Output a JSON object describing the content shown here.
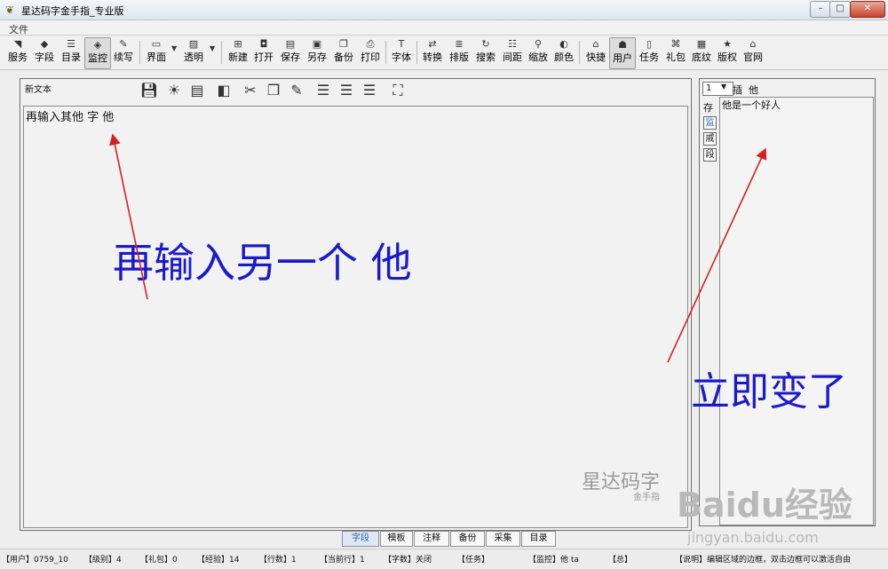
{
  "window": {
    "title": "星达码字金手指_专业版",
    "buttons": [
      "–",
      "□",
      "✕"
    ]
  },
  "menu": {
    "file": "文件"
  },
  "toolbar": {
    "items": [
      {
        "label": "服务",
        "icon": "rss-icon"
      },
      {
        "label": "字段",
        "icon": "diamond-icon"
      },
      {
        "label": "目录",
        "icon": "list-icon"
      },
      {
        "label": "监控",
        "icon": "shield-icon",
        "active": true
      },
      {
        "label": "续写",
        "icon": "pen-icon"
      },
      {
        "label": "界面",
        "icon": "window-icon"
      },
      {
        "label": "透明",
        "icon": "image-icon"
      },
      {
        "label": "新建",
        "icon": "new-file-icon"
      },
      {
        "label": "打开",
        "icon": "open-icon"
      },
      {
        "label": "保存",
        "icon": "save-icon"
      },
      {
        "label": "另存",
        "icon": "save-as-icon"
      },
      {
        "label": "备份",
        "icon": "backup-icon"
      },
      {
        "label": "打印",
        "icon": "print-icon"
      },
      {
        "label": "字体",
        "icon": "font-icon"
      },
      {
        "label": "转换",
        "icon": "convert-icon"
      },
      {
        "label": "排版",
        "icon": "layout-icon"
      },
      {
        "label": "搜索",
        "icon": "refresh-icon"
      },
      {
        "label": "间距",
        "icon": "spacing-icon"
      },
      {
        "label": "缩放",
        "icon": "zoom-icon"
      },
      {
        "label": "颜色",
        "icon": "palette-icon"
      },
      {
        "label": "快捷",
        "icon": "shortcut-icon"
      },
      {
        "label": "用户",
        "icon": "user-icon",
        "active": true
      },
      {
        "label": "任务",
        "icon": "task-icon"
      },
      {
        "label": "礼包",
        "icon": "gift-icon"
      },
      {
        "label": "底纹",
        "icon": "texture-icon"
      },
      {
        "label": "版权",
        "icon": "star-icon"
      },
      {
        "label": "官网",
        "icon": "home-icon"
      }
    ]
  },
  "editor": {
    "name": "新文本",
    "text": "再输入其他 字 他",
    "annotation": "再输入另一个  他",
    "watermark_main": "星达码字",
    "watermark_sub": "金手指"
  },
  "side": {
    "select_value": "1",
    "insert_label": "插",
    "word": "他",
    "store_label": "存",
    "boxes": [
      "监",
      "戚",
      "段"
    ],
    "text": "他是一个好人",
    "annotation": "立即变了"
  },
  "tabs": [
    {
      "label": "字段",
      "active": true
    },
    {
      "label": "模板"
    },
    {
      "label": "注释"
    },
    {
      "label": "备份"
    },
    {
      "label": "采集"
    },
    {
      "label": "目录"
    }
  ],
  "status": [
    "【用户】0759_10",
    "【级别】4",
    "【礼包】0",
    "【经验】14",
    "【行数】1",
    "【当前行】1",
    "【字数】关闭",
    "【任务】",
    "【监控】他 ta",
    "【总】",
    "【说明】编辑区域的边框，双击边框可以激活自由"
  ],
  "baidu": {
    "main": "Baidu经验",
    "url": "jingyan.baidu.com"
  },
  "colors": {
    "annotation": "#1a1acc",
    "arrow": "#d62020"
  }
}
